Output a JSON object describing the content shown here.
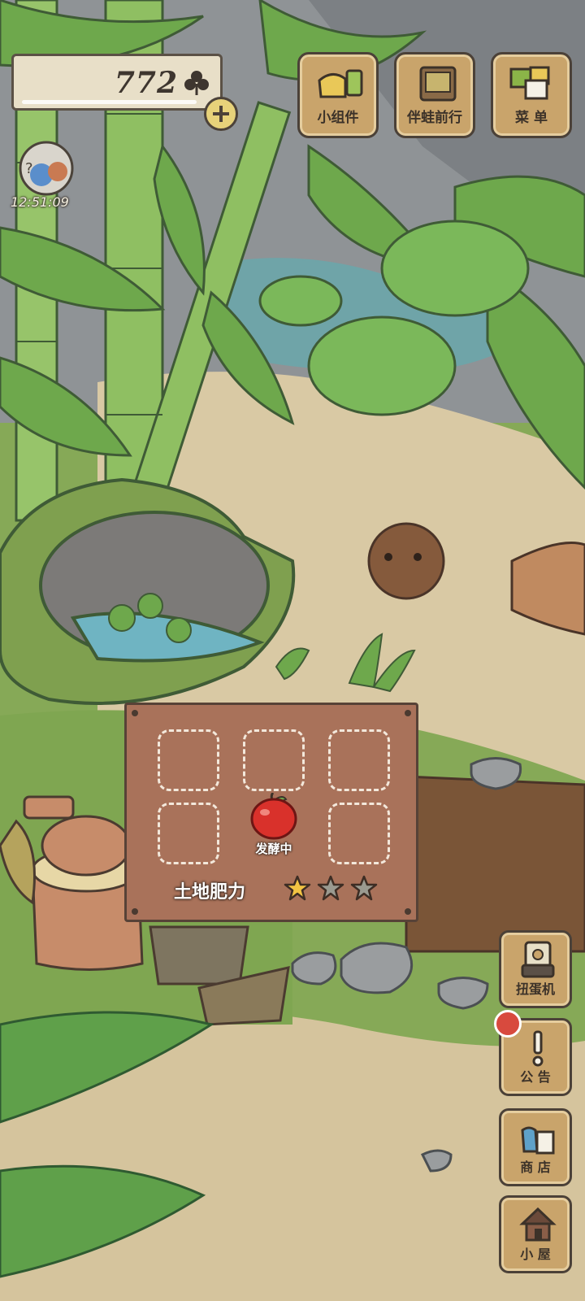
{
  "hud": {
    "clover_count": "772",
    "clover_icon": "clover-icon",
    "add_icon": "plus-icon",
    "timer": "12:51:09"
  },
  "top_menu": [
    {
      "label": "小组件",
      "icon": "widget-icon"
    },
    {
      "label": "伴蛙前行",
      "icon": "book-icon"
    },
    {
      "label": "菜 单",
      "icon": "menu-icon"
    }
  ],
  "side_menu": [
    {
      "label": "扭蛋机",
      "icon": "gacha-icon"
    },
    {
      "label": "公 告",
      "icon": "exclamation-icon"
    },
    {
      "label": "商 店",
      "icon": "shop-bag-icon"
    },
    {
      "label": "小 屋",
      "icon": "house-icon"
    }
  ],
  "garden": {
    "item_state": "发酵中",
    "item_icon": "red-apple-icon",
    "fertility_label": "土地肥力",
    "fertility_stars": 1,
    "fertility_max": 3
  },
  "colors": {
    "panel_wood": "#a9725a",
    "button_wood": "#c9a46b",
    "grass": "#86a957",
    "notify_dot": "#d84a3e",
    "star_gold": "#f2c443",
    "star_empty": "#9a9a90"
  }
}
